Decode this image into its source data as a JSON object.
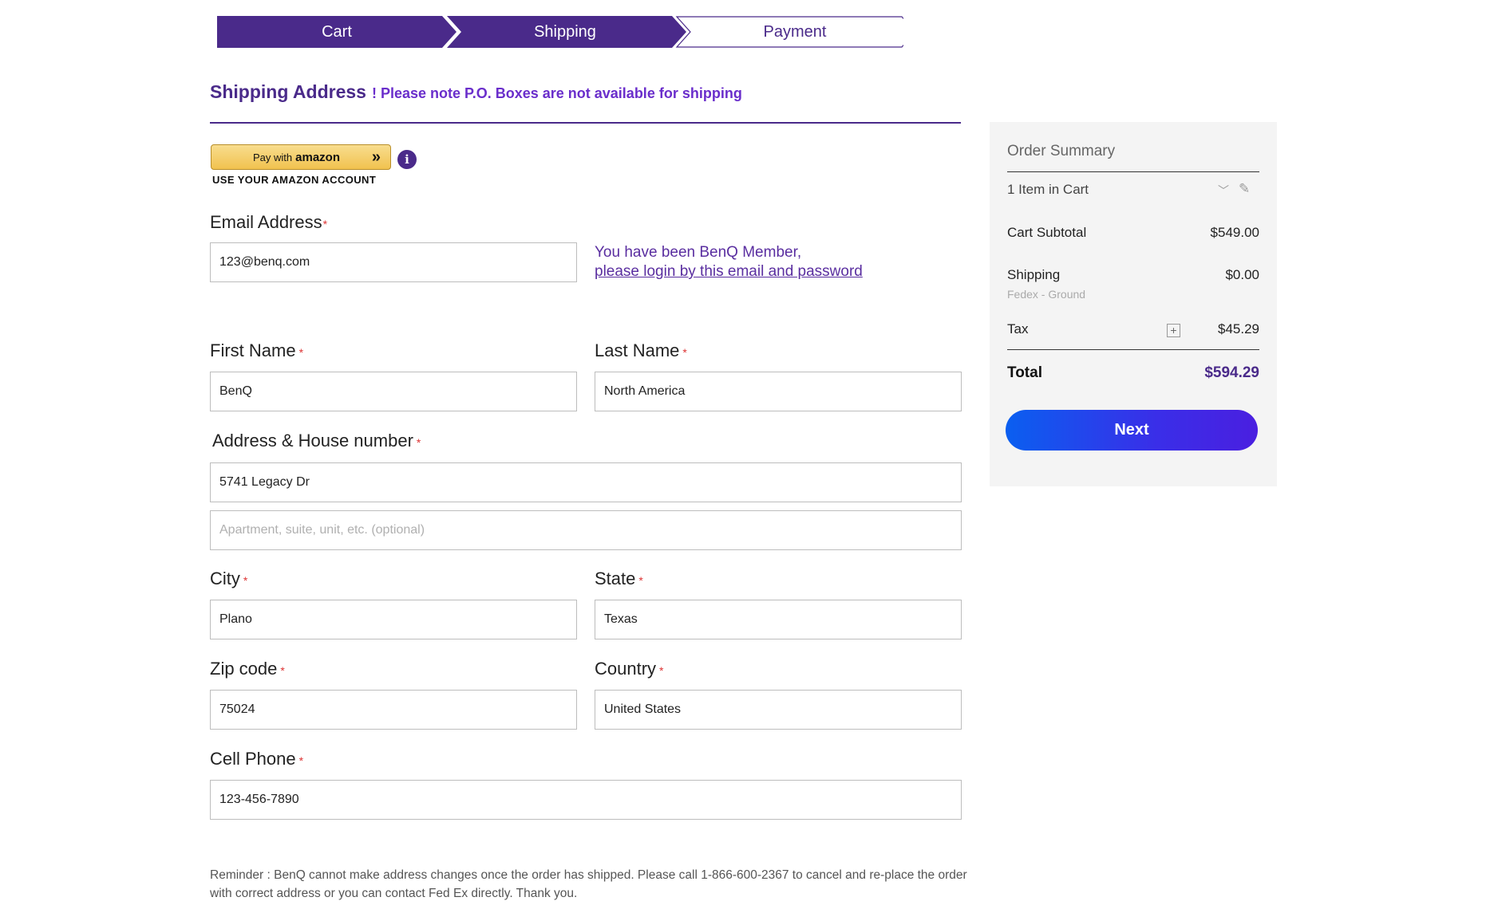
{
  "steps": [
    {
      "label": "Cart",
      "state": "complete"
    },
    {
      "label": "Shipping",
      "state": "active"
    },
    {
      "label": "Payment",
      "state": "pending"
    }
  ],
  "colors": {
    "brand": "#4a2a8a",
    "accent": "#6a2ecb",
    "required": "#d33333",
    "button_start": "#0a5ff0",
    "button_end": "#4a1fe0"
  },
  "header": {
    "title": "Shipping Address",
    "note": "! Please note P.O. Boxes are not available for shipping"
  },
  "amazon": {
    "button_prefix": "Pay with",
    "button_brand": "amazon",
    "caption": "USE YOUR AMAZON ACCOUNT"
  },
  "form": {
    "email": {
      "label": "Email Address",
      "value": "123@benq.com"
    },
    "member_note": "You have been BenQ Member,",
    "member_link": "please login by this email and password",
    "first_name": {
      "label": "First Name",
      "value": "BenQ"
    },
    "last_name": {
      "label": "Last Name",
      "value": "North America"
    },
    "address": {
      "label": "Address & House number",
      "value": "5741 Legacy Dr"
    },
    "address2": {
      "placeholder": "Apartment, suite, unit, etc. (optional)",
      "value": ""
    },
    "city": {
      "label": "City",
      "value": "Plano"
    },
    "state": {
      "label": "State",
      "value": "Texas"
    },
    "zip": {
      "label": "Zip code",
      "value": "75024"
    },
    "country": {
      "label": "Country",
      "value": "United States"
    },
    "phone": {
      "label": "Cell Phone",
      "value": "123-456-7890"
    },
    "required_mark": "*"
  },
  "reminder": "Reminder : BenQ cannot make address changes once the order has shipped. Please call 1-866-600-2367 to cancel and re-place the order with correct address or you can contact Fed Ex directly. Thank you.",
  "summary": {
    "title": "Order Summary",
    "items": "1 Item in Cart",
    "cart_subtotal_label": "Cart Subtotal",
    "cart_subtotal_value": "$549.00",
    "shipping_label": "Shipping",
    "shipping_value": "$0.00",
    "shipping_method": "Fedex - Ground",
    "tax_label": "Tax",
    "tax_value": "$45.29",
    "total_label": "Total",
    "total_value": "$594.29",
    "next_label": "Next"
  }
}
